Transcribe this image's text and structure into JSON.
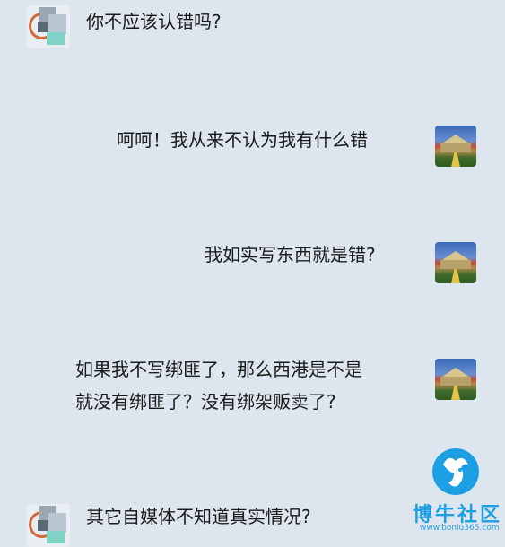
{
  "conversation": {
    "messages": [
      {
        "sender": "other",
        "lines": [
          "你不应该认错吗?"
        ]
      },
      {
        "sender": "self",
        "lines": [
          "呵呵！我从来不认为我有什么错"
        ]
      },
      {
        "sender": "self",
        "lines": [
          "我如实写东西就是错?"
        ]
      },
      {
        "sender": "self",
        "lines": [
          "如果我不写绑匪了，那么西港是不是",
          "就没有绑匪了？没有绑架贩卖了?"
        ]
      },
      {
        "sender": "other",
        "lines": [
          "其它自媒体不知道真实情况?"
        ]
      }
    ]
  },
  "watermark": {
    "name": "博牛社区",
    "url": "www.boniu365.com",
    "color": "#1c9fe3"
  },
  "colors": {
    "background": "#dde6ee",
    "text": "#1a1a1a"
  }
}
